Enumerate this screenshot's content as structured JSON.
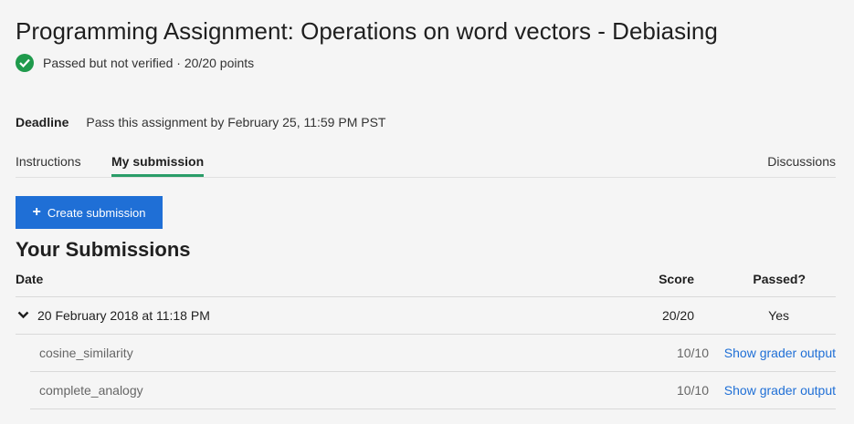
{
  "page": {
    "title": "Programming Assignment: Operations on word vectors - Debiasing",
    "status": "Passed but not verified · 20/20 points"
  },
  "deadline": {
    "label": "Deadline",
    "text": "Pass this assignment by February 25, 11:59 PM PST"
  },
  "tabs": {
    "instructions": "Instructions",
    "my_submission": "My submission",
    "discussions": "Discussions"
  },
  "actions": {
    "create_submission": "Create submission"
  },
  "submissions": {
    "title": "Your Submissions",
    "headers": {
      "date": "Date",
      "score": "Score",
      "passed": "Passed?"
    },
    "main": {
      "date": "20 February 2018 at 11:18 PM",
      "score": "20/20",
      "passed": "Yes"
    },
    "parts": [
      {
        "name": "cosine_similarity",
        "score": "10/10",
        "link": "Show grader output"
      },
      {
        "name": "complete_analogy",
        "score": "10/10",
        "link": "Show grader output"
      }
    ]
  },
  "colors": {
    "accent": "#1f6fd6",
    "success": "#1f9a4c",
    "tab_underline": "#2a9d68"
  },
  "icons": {
    "status": "check-circle-icon",
    "expand": "chevron-down-icon",
    "add": "plus-icon"
  }
}
